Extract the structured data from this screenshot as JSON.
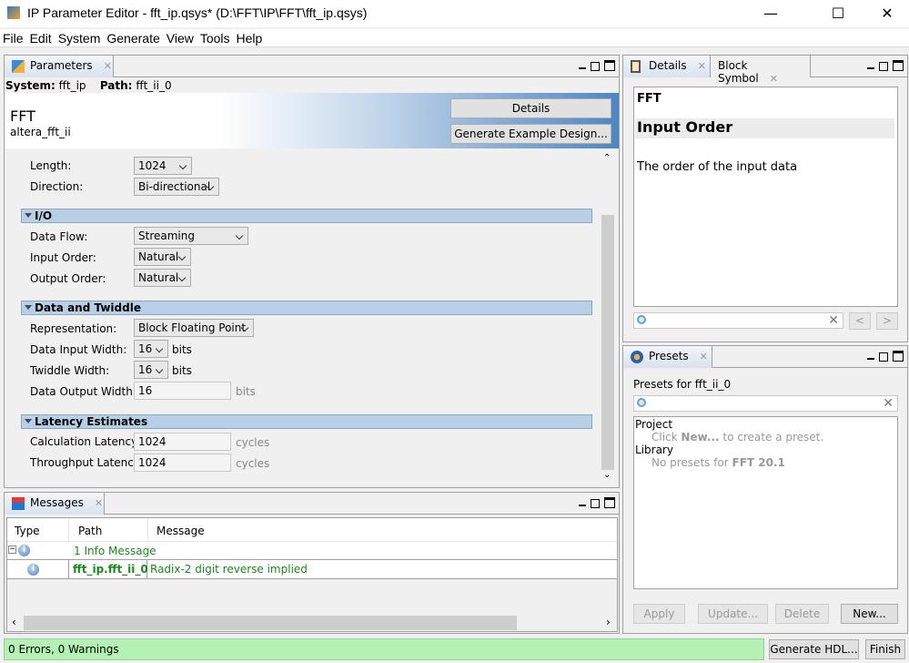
{
  "window": {
    "title": "IP Parameter Editor - fft_ip.qsys* (D:\\FFT\\IP\\FFT\\fft_ip.qsys)",
    "minimize": "—",
    "maximize": "☐",
    "close": "✕"
  },
  "menu": [
    "File",
    "Edit",
    "System",
    "Generate",
    "View",
    "Tools",
    "Help"
  ],
  "parameters": {
    "tab": "Parameters",
    "system_label": "System:",
    "system_value": "fft_ip",
    "path_label": "Path:",
    "path_value": "fft_ii_0",
    "component_title": "FFT",
    "component_name": "altera_fft_ii",
    "details_button": "Details",
    "example_button": "Generate Example Design...",
    "fields": [
      {
        "label": "Length:",
        "value": "1024"
      },
      {
        "label": "Direction:",
        "value": "Bi-directional"
      }
    ],
    "sections": [
      {
        "title": "I/O",
        "fields": [
          {
            "label": "Data Flow:",
            "value": "Streaming"
          },
          {
            "label": "Input Order:",
            "value": "Natural"
          },
          {
            "label": "Output Order:",
            "value": "Natural"
          }
        ]
      },
      {
        "title": "Data and Twiddle",
        "fields": [
          {
            "label": "Representation:",
            "value": "Block Floating Point"
          },
          {
            "label": "Data Input Width:",
            "value": "16",
            "unit": "bits"
          },
          {
            "label": "Twiddle Width:",
            "value": "16",
            "unit": "bits"
          },
          {
            "label": "Data Output Width:",
            "value": "16",
            "unit": "bits"
          }
        ]
      },
      {
        "title": "Latency Estimates",
        "fields": [
          {
            "label": "Calculation Latency:",
            "value": "1024",
            "unit": "cycles"
          },
          {
            "label": "Throughput Latency:",
            "value": "1024",
            "unit": "cycles"
          }
        ]
      }
    ]
  },
  "details": {
    "tabs": [
      "Details",
      "Block Symbol"
    ],
    "heading_small": "FFT",
    "heading": "Input Order",
    "text": "The order of the input data",
    "prev": "<",
    "next": ">"
  },
  "presets": {
    "tab": "Presets",
    "label": "Presets for fft_ii_0",
    "project": "Project",
    "project_hint_pre": "Click ",
    "project_hint_bold": "New...",
    "project_hint_post": " to create a preset.",
    "library": "Library",
    "library_hint_pre": "No presets for ",
    "library_hint_bold": "FFT 20.1",
    "buttons": [
      "Apply",
      "Update...",
      "Delete",
      "New..."
    ]
  },
  "messages": {
    "tab": "Messages",
    "columns": [
      "Type",
      "Path",
      "Message"
    ],
    "group": "1 Info Message",
    "rows": [
      {
        "path": "fft_ip.fft_ii_0",
        "message": "Radix-2 digit reverse implied"
      }
    ]
  },
  "status": {
    "text": "0 Errors, 0 Warnings",
    "generate": "Generate HDL...",
    "finish": "Finish"
  },
  "colors": {
    "status_bg": "#b3f2b3",
    "section_bg": "#b8cfe5",
    "message_green": "#1a8a1a"
  }
}
